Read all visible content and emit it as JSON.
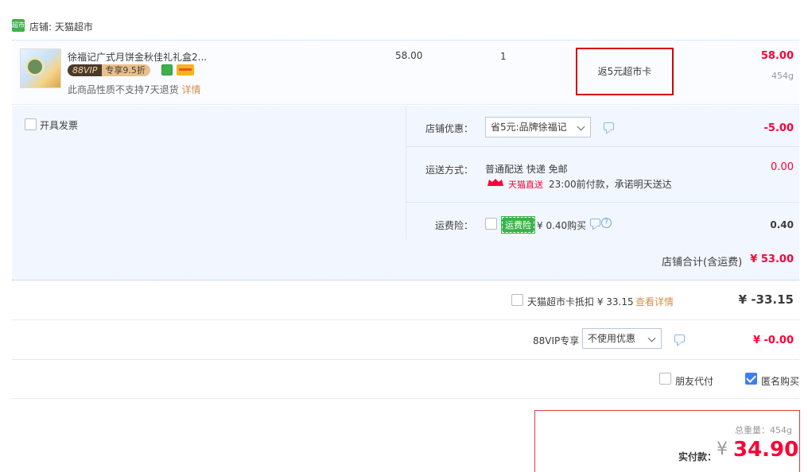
{
  "store": {
    "icon": "tmall-supermarket-icon",
    "label": "店铺: 天猫超市",
    "icon_text": "超市"
  },
  "item": {
    "title": "徐福记广式月饼金秋佳礼礼盒2...",
    "vip_tag_a": "88VIP",
    "vip_tag_b": "专享9.5折",
    "note": "此商品性质不支持7天退货",
    "note_link": "详情",
    "unit_price": "58.00",
    "quantity": "1",
    "promo": "返5元超市卡",
    "subtotal": "58.00",
    "weight": "454g"
  },
  "invoice": {
    "label": "开具发票"
  },
  "shop_discount": {
    "label": "店铺优惠：",
    "selected": "省5元:品牌徐福记",
    "amount": "-5.00"
  },
  "shipping": {
    "label": "运送方式：",
    "method": "普通配送 快递 免邮",
    "badge": "天猫直送",
    "promise": "23:00前付款，承诺明天送达",
    "amount": "0.00"
  },
  "insurance": {
    "label": "运费险：",
    "tag": "运费险",
    "price": "¥ 0.40购买",
    "amount": "0.40"
  },
  "store_total": {
    "label": "店铺合计(含运费)",
    "amount": "¥ 53.00"
  },
  "card_deduct": {
    "label": "天猫超市卡抵扣 ¥ 33.15",
    "link": "查看详情",
    "amount": "¥ -33.15"
  },
  "vip": {
    "label": "88VIP专享",
    "selected": "不使用优惠",
    "amount": "¥ -0.00"
  },
  "options": {
    "friend_pay": "朋友代付",
    "anonymous": "匿名购买"
  },
  "payment": {
    "weight_label": "总重量：454g",
    "pay_label": "实付款：",
    "currency": "¥",
    "amount": "34.90"
  },
  "colors": {
    "accent_red": "#ff0036",
    "border_red": "#d40000",
    "light_blue_bg": "#f2f7ff",
    "check_blue": "#3d7ef0"
  }
}
